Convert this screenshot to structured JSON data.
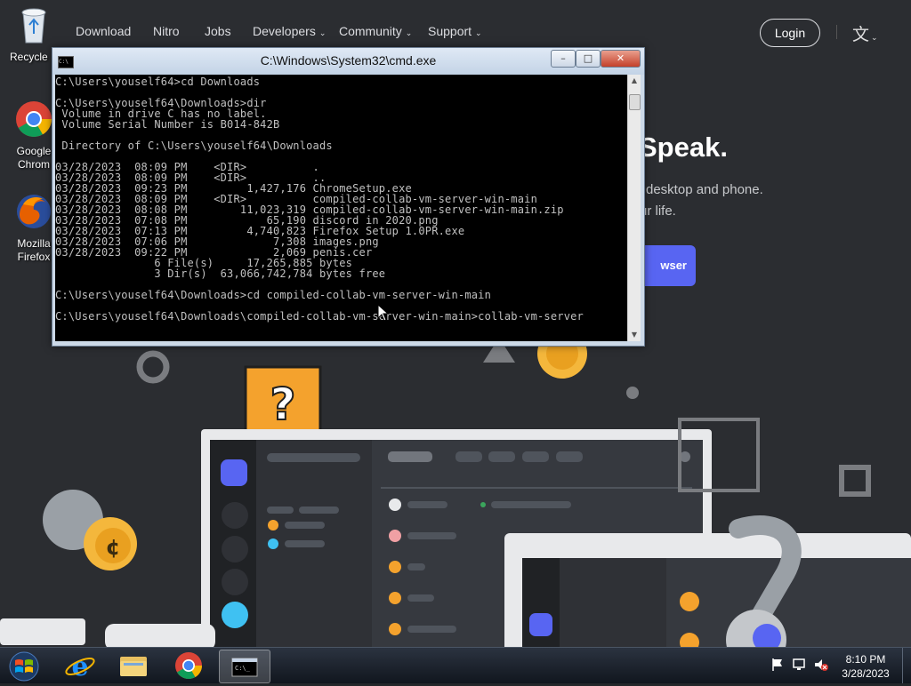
{
  "website": {
    "nav": [
      "Download",
      "Nitro",
      "Jobs",
      "Developers",
      "Community",
      "Support"
    ],
    "nav_dropdowns": [
      false,
      false,
      false,
      true,
      true,
      true
    ],
    "login": "Login",
    "hero_title": "Speak.",
    "hero_text_1": "desktop and phone.",
    "hero_text_2": "ur life.",
    "hero_button": "wser"
  },
  "desktop": {
    "icons": [
      {
        "label": "Recycle B",
        "icon": "recycle-bin-icon"
      },
      {
        "label": "Google Chrom",
        "icon": "chrome-icon"
      },
      {
        "label": "Mozilla Firefox",
        "icon": "firefox-icon"
      }
    ]
  },
  "cmd": {
    "title": "C:\\Windows\\System32\\cmd.exe",
    "icon_text": "C:\\",
    "lines": [
      "C:\\Users\\youself64>cd Downloads",
      "",
      "C:\\Users\\youself64\\Downloads>dir",
      " Volume in drive C has no label.",
      " Volume Serial Number is B014-842B",
      "",
      " Directory of C:\\Users\\youself64\\Downloads",
      "",
      "03/28/2023  08:09 PM    <DIR>          .",
      "03/28/2023  08:09 PM    <DIR>          ..",
      "03/28/2023  09:23 PM         1,427,176 ChromeSetup.exe",
      "03/28/2023  08:09 PM    <DIR>          compiled-collab-vm-server-win-main",
      "03/28/2023  08:08 PM        11,023,319 compiled-collab-vm-server-win-main.zip",
      "03/28/2023  07:08 PM            65,190 discord in 2020.png",
      "03/28/2023  07:13 PM         4,740,823 Firefox Setup 1.0PR.exe",
      "03/28/2023  07:06 PM             7,308 images.png",
      "03/28/2023  09:22 PM             2,069 penis.cer",
      "               6 File(s)     17,265,885 bytes",
      "               3 Dir(s)  63,066,742,784 bytes free",
      "",
      "C:\\Users\\youself64\\Downloads>cd compiled-collab-vm-server-win-main",
      "",
      "C:\\Users\\youself64\\Downloads\\compiled-collab-vm-server-win-main>collab-vm-server"
    ],
    "buttons": {
      "minimize": "–",
      "maximize": "□",
      "close": "✕"
    }
  },
  "taskbar": {
    "items": [
      {
        "name": "start-button",
        "icon": "windows-start-icon"
      },
      {
        "name": "taskbar-ie",
        "icon": "internet-explorer-icon"
      },
      {
        "name": "taskbar-explorer",
        "icon": "folder-icon"
      },
      {
        "name": "taskbar-chrome",
        "icon": "chrome-icon"
      },
      {
        "name": "taskbar-cmd",
        "icon": "cmd-icon",
        "active": true
      }
    ],
    "time": "8:10 PM",
    "date": "3/28/2023"
  }
}
